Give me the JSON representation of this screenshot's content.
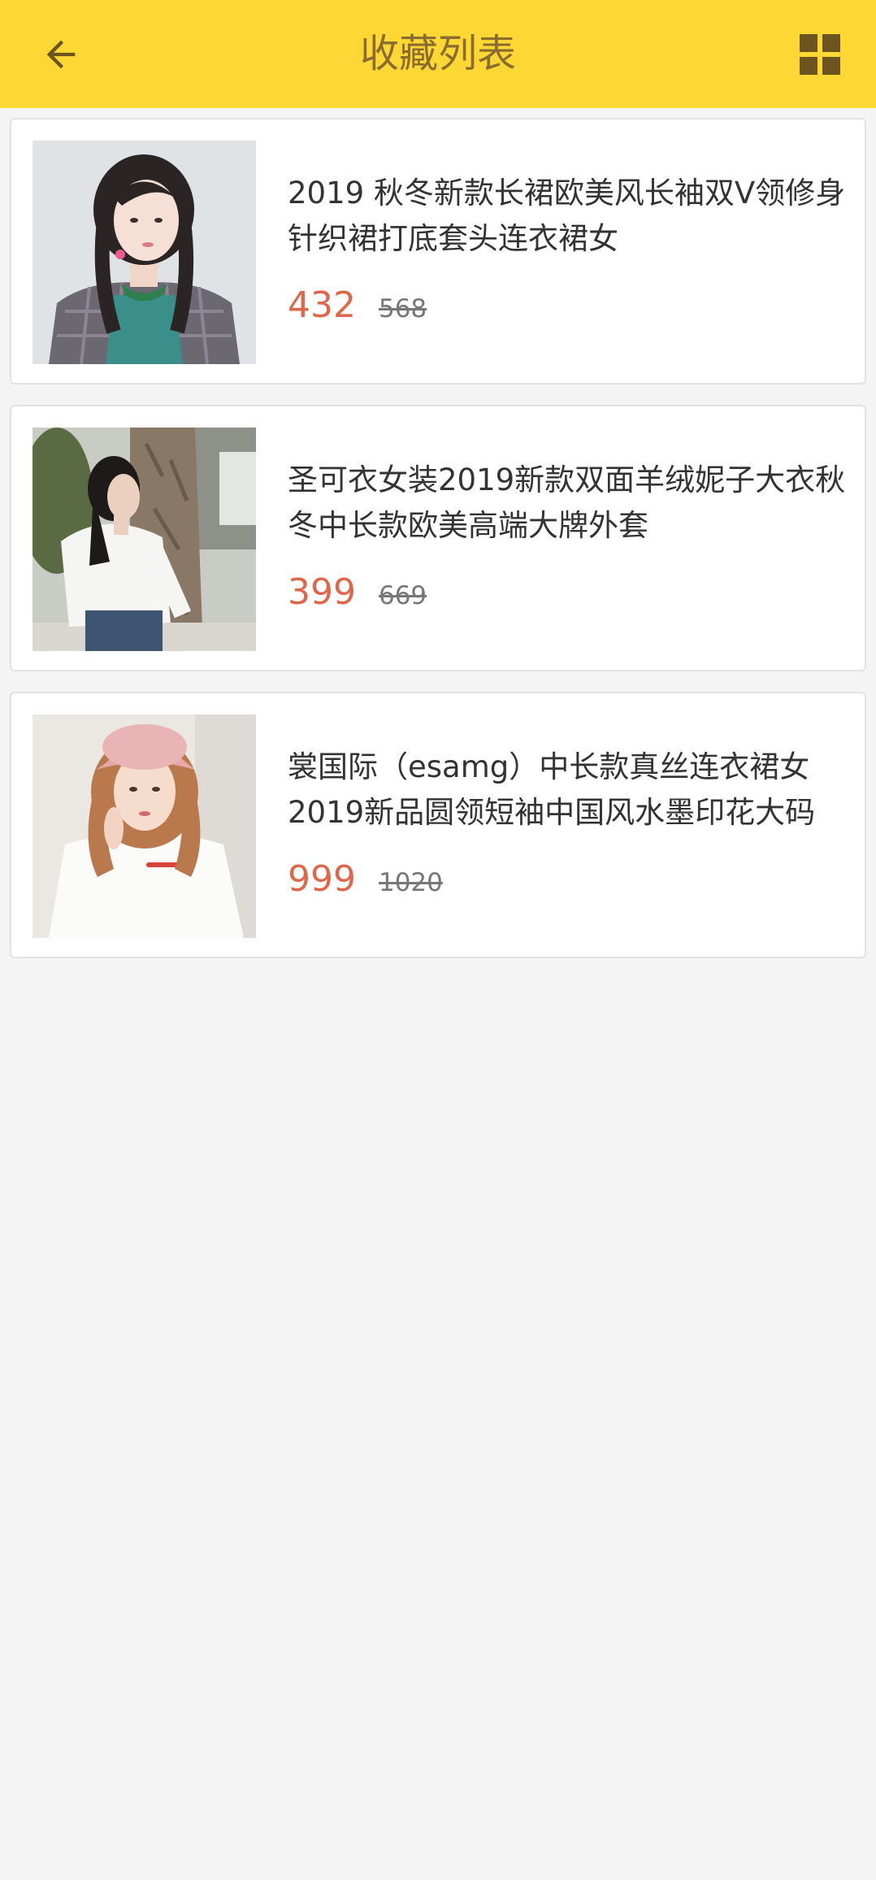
{
  "header": {
    "title": "收藏列表",
    "back_icon": "arrow-left-icon",
    "view_icon": "grid-view-icon"
  },
  "colors": {
    "appbar": "#fdd835",
    "title": "#8a6d2e",
    "price": "#e0664a",
    "background": "#f4f4f4"
  },
  "items": [
    {
      "name": "2019 秋冬新款长裙欧美风长袖双V领修身针织裙打底套头连衣裙女",
      "price": "432",
      "original_price": "568"
    },
    {
      "name": "圣可衣女装2019新款双面羊绒妮子大衣秋冬中长款欧美高端大牌外套",
      "price": "399",
      "original_price": "669"
    },
    {
      "name": "裳国际（esamg）中长款真丝连衣裙女2019新品圆领短袖中国风水墨印花大码",
      "price": "999",
      "original_price": "1020"
    }
  ]
}
